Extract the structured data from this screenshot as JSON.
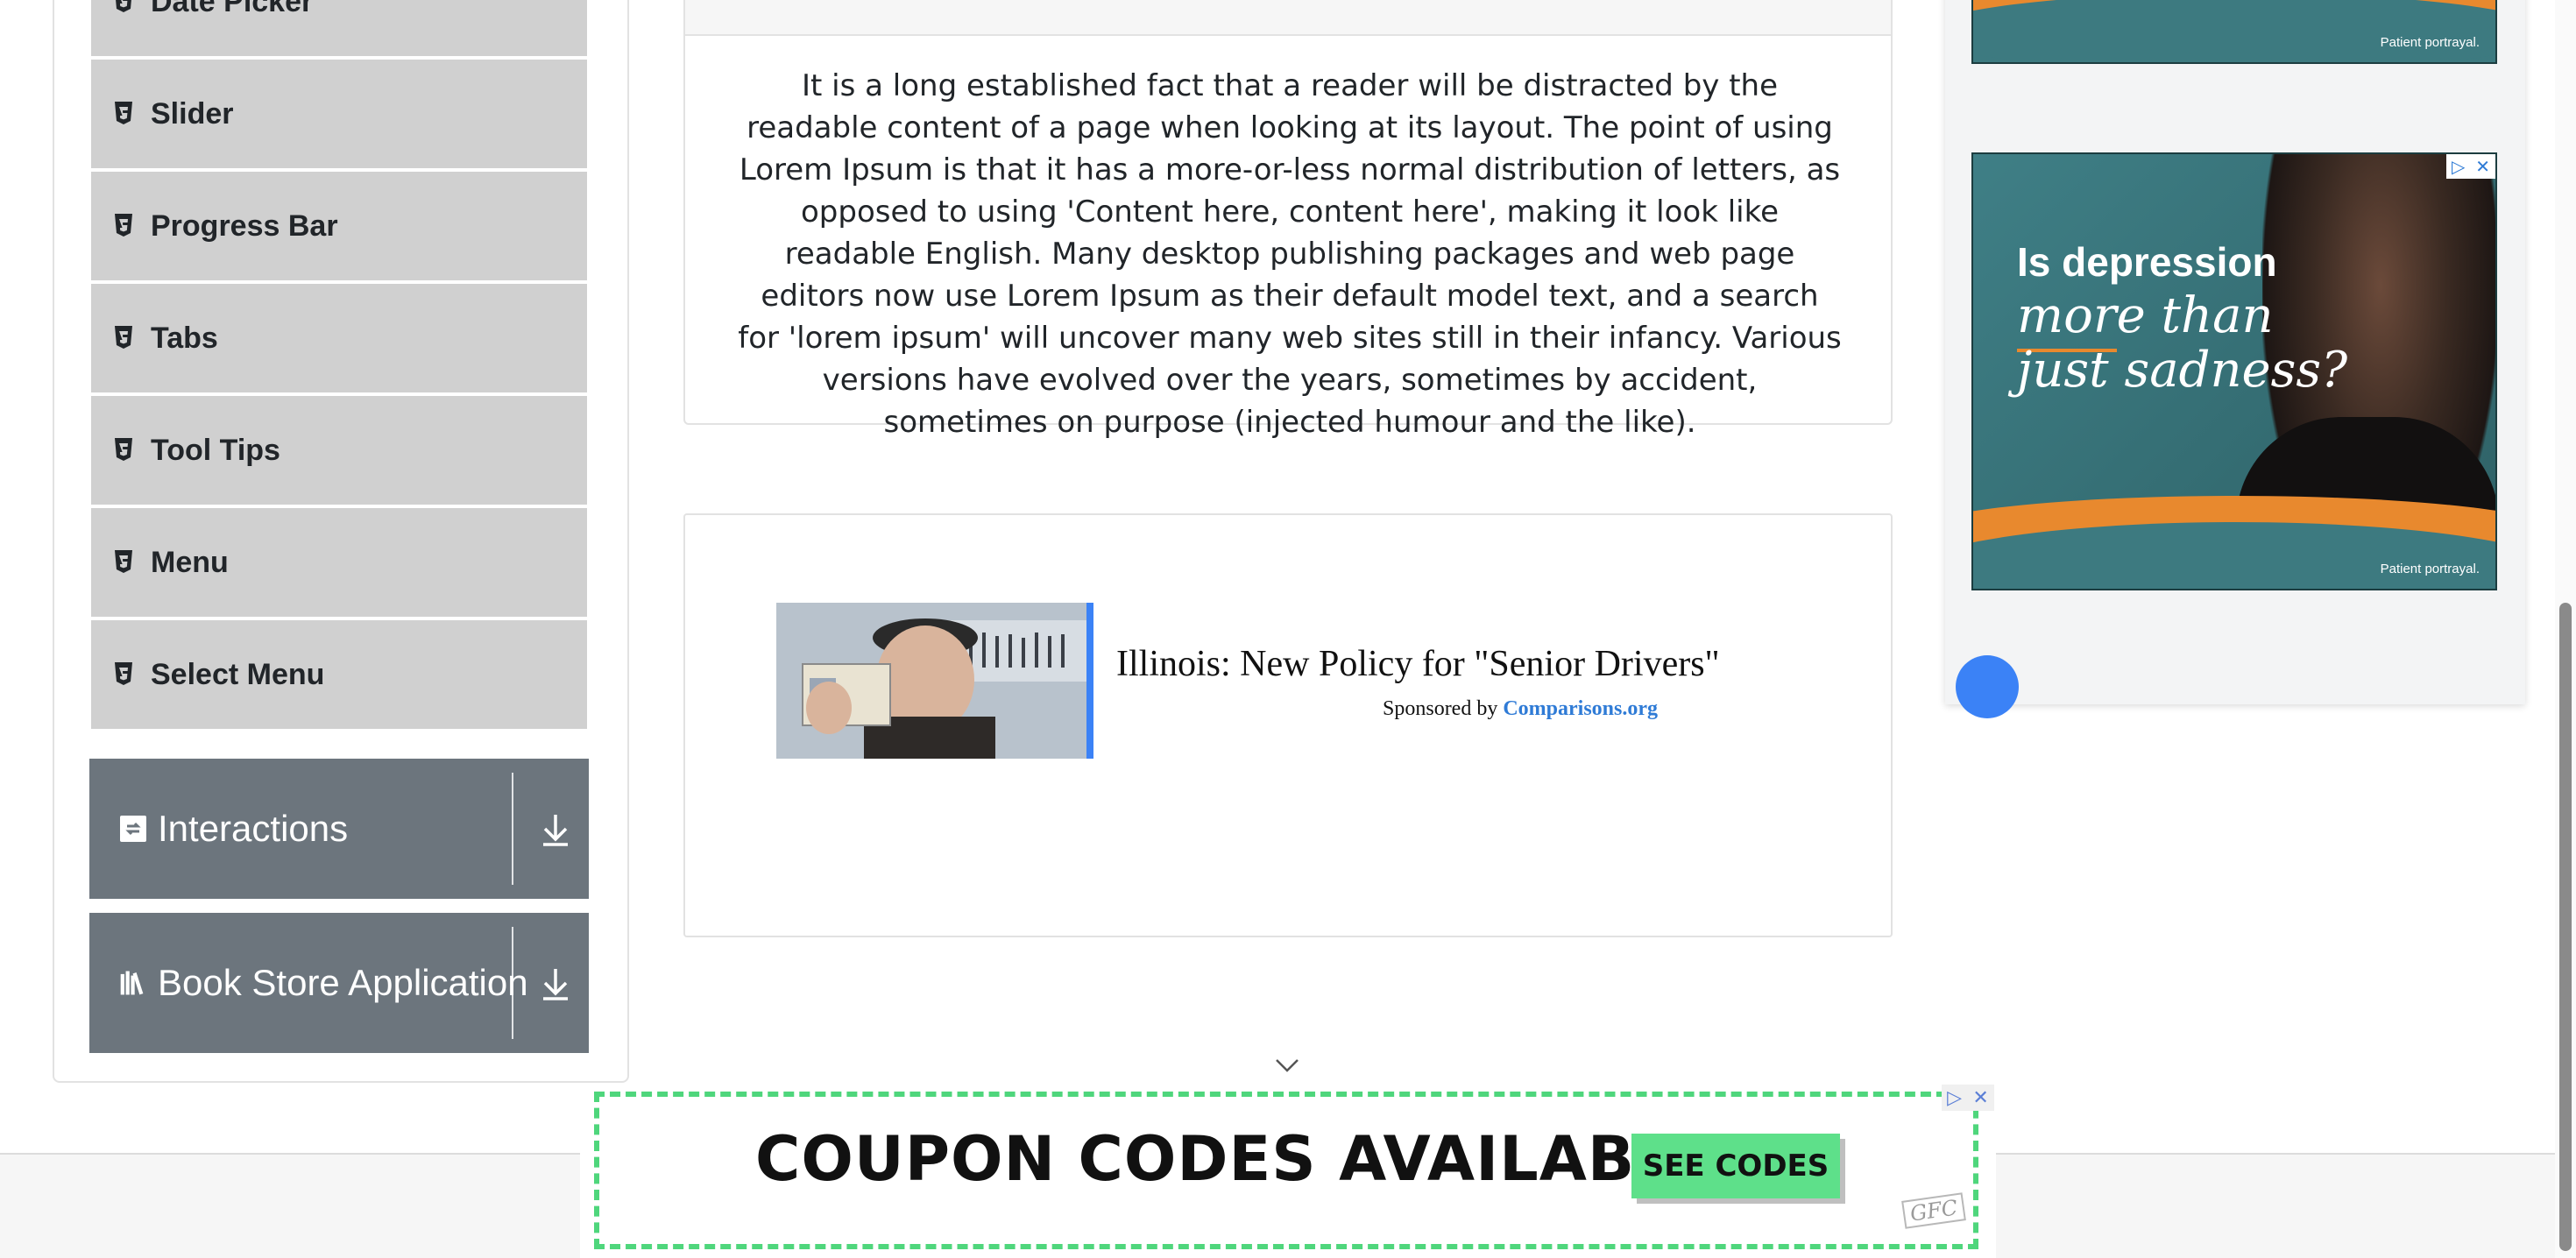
{
  "sidebar": {
    "partial_item_label": "Date Picker",
    "items": [
      {
        "label": "Slider"
      },
      {
        "label": "Progress Bar"
      },
      {
        "label": "Tabs"
      },
      {
        "label": "Tool Tips"
      },
      {
        "label": "Menu"
      },
      {
        "label": "Select Menu"
      }
    ],
    "groups": [
      {
        "label": "Interactions",
        "icon": "interactions-icon"
      },
      {
        "label": "Book Store Application",
        "icon": "book-store-icon"
      }
    ]
  },
  "main": {
    "paragraph": "It is a long established fact that a reader will be distracted by the readable content of a page when looking at its layout. The point of using Lorem Ipsum is that it has a more-or-less normal distribution of letters, as opposed to using 'Content here, content here', making it look like readable English. Many desktop publishing packages and web page editors now use Lorem Ipsum as their default model text, and a search for 'lorem ipsum' will uncover many web sites still in their infancy. Various versions have evolved over the years, sometimes by accident, sometimes on purpose (injected humour and the like).",
    "ad": {
      "headline": "Illinois: New Policy for \"Senior Drivers\"",
      "sponsor_prefix": "Sponsored by",
      "sponsor_name": "Comparisons.org"
    }
  },
  "right_ads": {
    "portrayal_top": "Patient portrayal.",
    "portrayal_main": "Patient portrayal.",
    "line1": "Is depression",
    "line2": "more than",
    "line3": "just sadness?"
  },
  "banner": {
    "headline": "COUPON CODES AVAILABLE",
    "button": "SEE CODES",
    "logo": "GFC"
  },
  "colors": {
    "sidebar_item_bg": "#d0d0d0",
    "group_header_bg": "#6c757d",
    "banner_accent": "#4fd67c",
    "ad_teal": "#3d7a80",
    "ad_orange": "#e8892e"
  }
}
